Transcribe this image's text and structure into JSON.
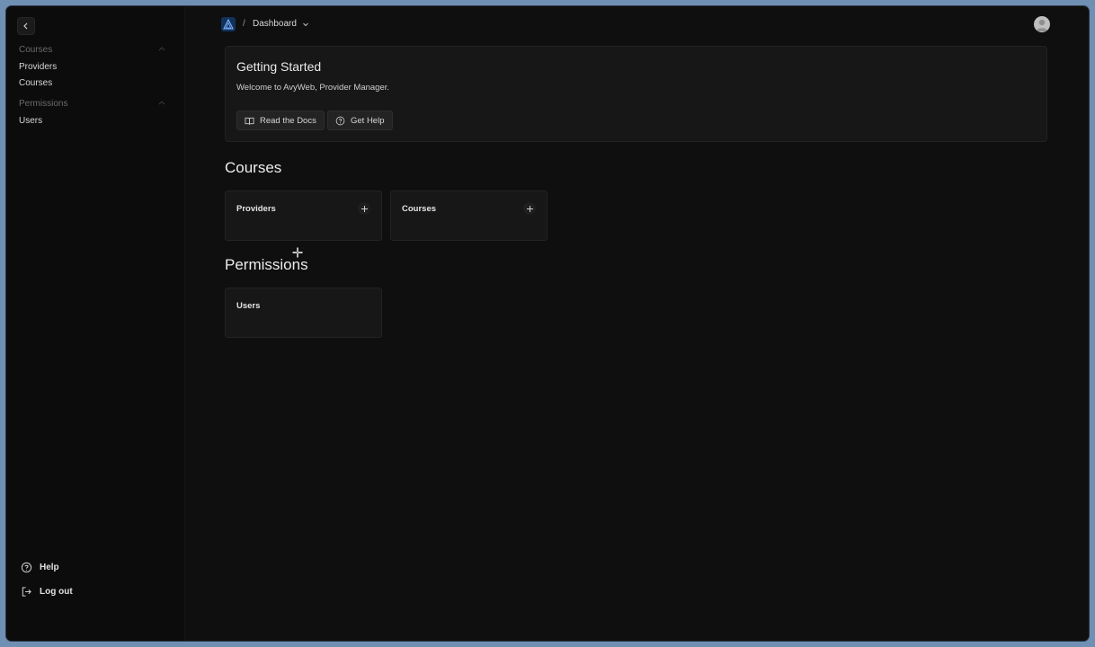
{
  "sidebar": {
    "sections": [
      {
        "title": "Courses",
        "items": [
          "Providers",
          "Courses"
        ]
      },
      {
        "title": "Permissions",
        "items": [
          "Users"
        ]
      }
    ],
    "bottom": {
      "help": "Help",
      "logout": "Log out"
    }
  },
  "topbar": {
    "separator": "/",
    "breadcrumb": "Dashboard"
  },
  "getting_started": {
    "title": "Getting Started",
    "text": "Welcome to AvyWeb, Provider Manager.",
    "docs_button": "Read the Docs",
    "help_button": "Get Help"
  },
  "main": {
    "courses_heading": "Courses",
    "courses_tiles": [
      "Providers",
      "Courses"
    ],
    "permissions_heading": "Permissions",
    "permissions_tiles": [
      "Users"
    ]
  },
  "colors": {
    "background": "#0f0f0f",
    "card": "#171717",
    "accent_logo": "#12325b"
  }
}
